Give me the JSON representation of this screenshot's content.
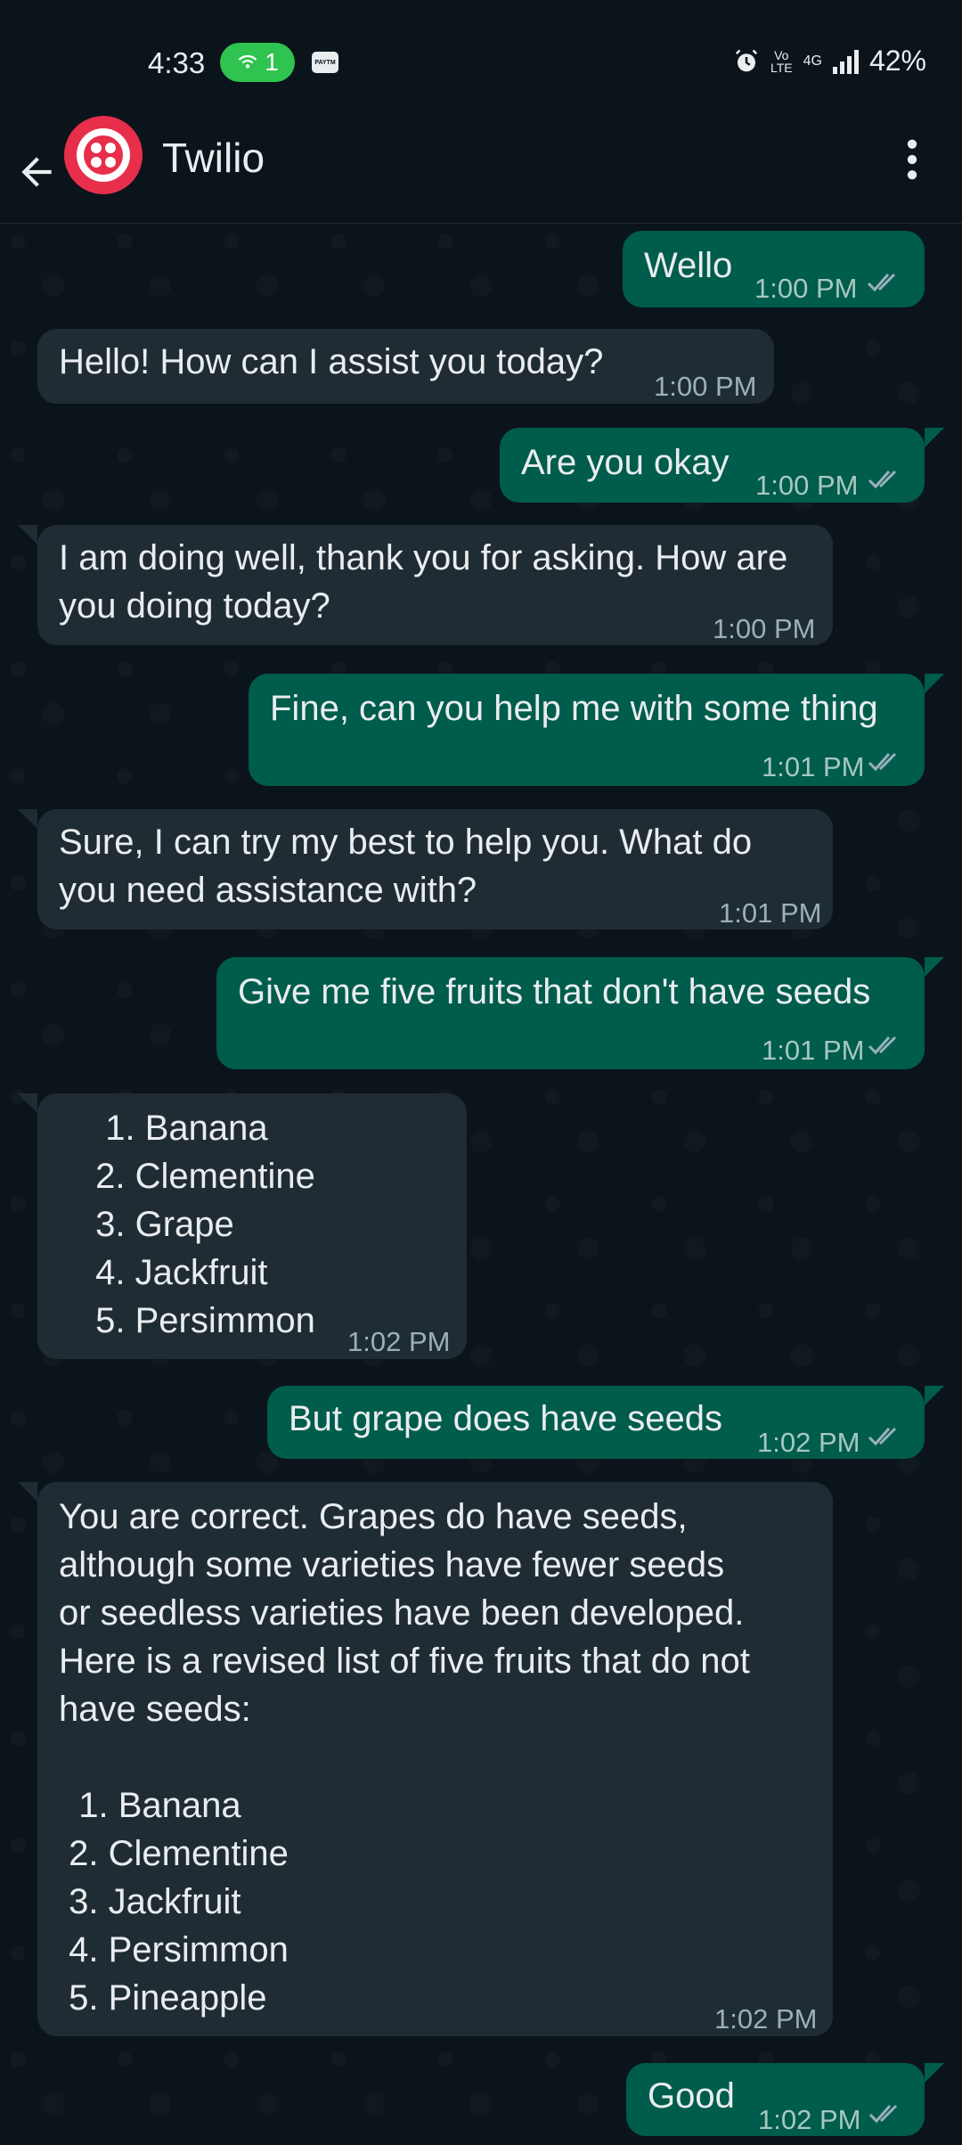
{
  "status_bar": {
    "time": "4:33",
    "hotspot_count": "1",
    "paytm": "PAYTM",
    "volte": "Vo\nLTE",
    "network": "4G",
    "battery": "42%"
  },
  "header": {
    "contact_name": "Twilio",
    "avatar_color": "#e72e4b"
  },
  "messages": [
    {
      "dir": "out",
      "text": "Wello",
      "time": "1:00 PM"
    },
    {
      "dir": "in",
      "text": "Hello! How can I assist you today?",
      "time": "1:00 PM"
    },
    {
      "dir": "out",
      "text": "Are you okay",
      "time": "1:00 PM"
    },
    {
      "dir": "in",
      "text": "I am doing well, thank you for asking. How are\nyou doing today?",
      "time": "1:00 PM"
    },
    {
      "dir": "out",
      "text": "Fine, can you help me with some thing",
      "time": "1:01 PM"
    },
    {
      "dir": "in",
      "text": "Sure, I can try my best to help you. What do\nyou need assistance with?",
      "time": "1:01 PM"
    },
    {
      "dir": "out",
      "text": "Give me five fruits that don't have seeds",
      "time": "1:01 PM"
    },
    {
      "dir": "in",
      "text": "  1. Banana\n 2. Clementine\n 3. Grape\n 4. Jackfruit\n 5. Persimmon",
      "time": "1:02 PM"
    },
    {
      "dir": "out",
      "text": "But grape does have seeds",
      "time": "1:02 PM"
    },
    {
      "dir": "in",
      "text": "You are correct. Grapes do have seeds,\nalthough some varieties have fewer seeds\nor seedless varieties have been developed.\nHere is a revised list of five fruits that do not\nhave seeds:\n\n  1. Banana\n 2. Clementine\n 3. Jackfruit\n 4. Persimmon\n 5. Pineapple",
      "time": "1:02 PM"
    },
    {
      "dir": "out",
      "text": "Good",
      "time": "1:02 PM"
    }
  ],
  "colors": {
    "background": "#0b141a",
    "incoming_bubble": "#202c33",
    "outgoing_bubble": "#005c4b",
    "read_ticks": "#9ab0bd"
  }
}
